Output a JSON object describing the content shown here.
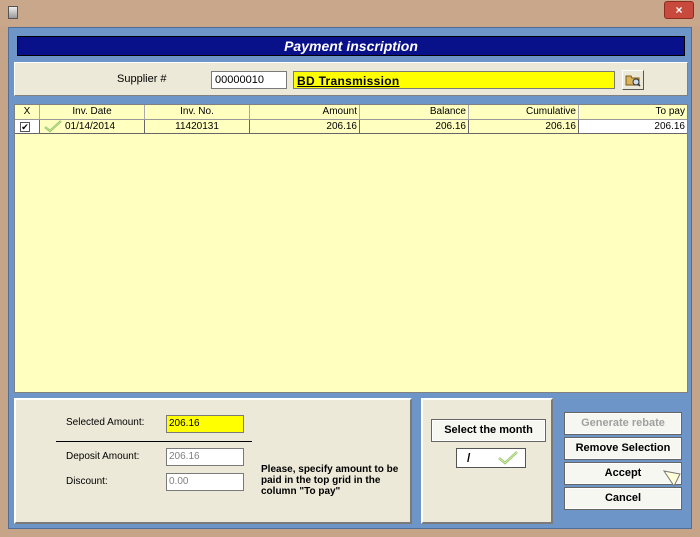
{
  "window": {
    "close_glyph": "×"
  },
  "header": {
    "title": "Payment inscription"
  },
  "supplier": {
    "label": "Supplier #",
    "number": "00000010",
    "name": "BD Transmission",
    "search_icon": "search-folder-icon"
  },
  "grid": {
    "columns": [
      "X",
      "Inv. Date",
      "Inv. No.",
      "Amount",
      "Balance",
      "Cumulative",
      "To pay"
    ],
    "rows": [
      {
        "checked": true,
        "inv_date": "01/14/2014",
        "inv_no": "11420131",
        "amount": "206.16",
        "balance": "206.16",
        "cumulative": "206.16",
        "to_pay": "206.16"
      }
    ]
  },
  "summary": {
    "selected_amount_label": "Selected Amount:",
    "selected_amount": "206.16",
    "deposit_amount_label": "Deposit Amount:",
    "deposit_amount": "206.16",
    "discount_label": "Discount:",
    "discount": "0.00",
    "note": "Please, specify amount to be paid in the top grid in the column \"To pay\""
  },
  "month": {
    "button_label": "Select the month",
    "value": "/"
  },
  "actions": {
    "generate_rebate": "Generate rebate",
    "remove_selection": "Remove Selection",
    "accept": "Accept",
    "cancel": "Cancel"
  },
  "colors": {
    "header_bg": "#08108a",
    "grid_bg": "#ffffc0",
    "highlight": "#ffff00",
    "window_bg": "#c6a488",
    "client_bg": "#6d95c8"
  }
}
